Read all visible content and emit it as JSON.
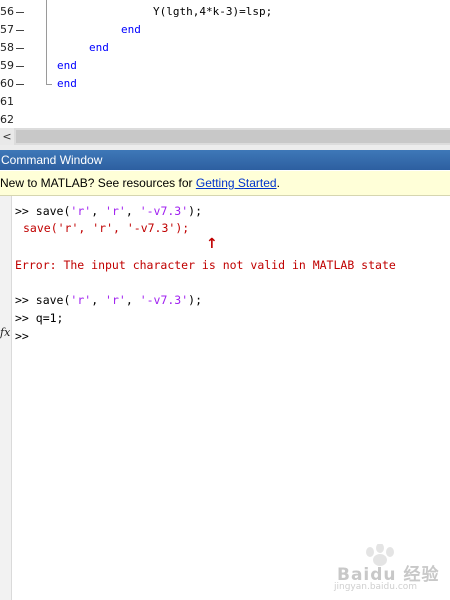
{
  "editor": {
    "lines": [
      {
        "num": "56",
        "text": "Y(lgth,4*k-3)=lsp;",
        "type": "code"
      },
      {
        "num": "57",
        "text": "end",
        "type": "kw"
      },
      {
        "num": "58",
        "text": "end",
        "type": "kw"
      },
      {
        "num": "59",
        "text": "end",
        "type": "kw"
      },
      {
        "num": "60",
        "text": "end",
        "type": "kw"
      },
      {
        "num": "61",
        "text": "",
        "type": "blank"
      },
      {
        "num": "62",
        "text": "",
        "type": "blank"
      }
    ]
  },
  "scrollbar": {
    "left_arrow": "<"
  },
  "command_window": {
    "title": "Command Window",
    "banner": {
      "prefix": "New to MATLAB? See resources for ",
      "link": "Getting Started",
      "suffix": "."
    },
    "fx_icon": "fx",
    "lines": {
      "l1_prompt": ">> ",
      "l1_cmd": "save(",
      "l1_s1": "'r'",
      "l1_sep1": ", ",
      "l1_s2": "'r'",
      "l1_sep2": ", ",
      "l1_s3": "'-v7.3'",
      "l1_end": ");",
      "l2_echo": "save('r', 'r', '-v7.3');",
      "caret": "↑",
      "error": "Error: The input character is not valid in MATLAB state",
      "l4_prompt": ">> ",
      "l4_cmd": "save(",
      "l4_s1": "'r'",
      "l4_sep1": ", ",
      "l4_s2": "'r'",
      "l4_sep2": ", ",
      "l4_s3": "'-v7.3'",
      "l4_end": ");",
      "l5": ">> q=1;",
      "l6": ">>"
    }
  },
  "watermark": {
    "text": "Baidu 经验",
    "url": "jingyan.baidu.com"
  }
}
